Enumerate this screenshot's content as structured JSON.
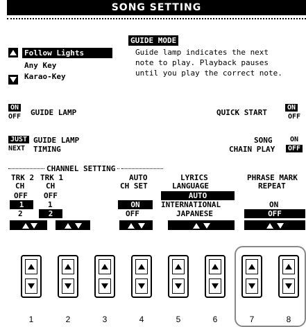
{
  "title": "SONG SETTING",
  "guide_mode": {
    "label": "GUIDE MODE",
    "options": [
      "Follow Lights",
      "Any Key",
      "Karao-Key"
    ],
    "selected_index": 0,
    "description": [
      "Guide lamp indicates the next",
      "note to play. Playback pauses",
      "until you play the correct note."
    ]
  },
  "guide_lamp": {
    "on": "ON",
    "off": "OFF",
    "label": "GUIDE LAMP",
    "selected": "ON"
  },
  "guide_lamp_timing": {
    "just": "JUST",
    "next": "NEXT",
    "label1": "GUIDE LAMP",
    "label2": "TIMING",
    "selected": "JUST"
  },
  "quick_start": {
    "label": "QUICK START",
    "on": "ON",
    "off": "OFF",
    "selected": "ON"
  },
  "song_chain_play": {
    "label1": "SONG",
    "label2": "CHAIN PLAY",
    "on": "ON",
    "off": "OFF",
    "selected": "OFF"
  },
  "channel_setting": {
    "label": "CHANNEL SETTING",
    "trk2": {
      "label": "TRK 2",
      "ch": "CH",
      "values": [
        "OFF",
        "1",
        "2"
      ],
      "selected": "1"
    },
    "trk1": {
      "label": "TRK 1",
      "ch": "CH",
      "values": [
        "OFF",
        "1",
        "2"
      ],
      "selected": "2"
    }
  },
  "auto_ch_set": {
    "label1": "AUTO",
    "label2": "CH SET",
    "values": [
      "ON",
      "OFF"
    ],
    "selected": "ON"
  },
  "lyrics_language": {
    "label1": "LYRICS",
    "label2": "LANGUAGE",
    "values": [
      "AUTO",
      "INTERNATIONAL",
      "JAPANESE"
    ],
    "selected": "AUTO"
  },
  "phrase_mark_repeat": {
    "label1": "PHRASE MARK",
    "label2": "REPEAT",
    "values": [
      "ON",
      "OFF"
    ],
    "selected": "OFF"
  },
  "hardware_buttons": [
    "1",
    "2",
    "3",
    "4",
    "5",
    "6",
    "7",
    "8"
  ]
}
